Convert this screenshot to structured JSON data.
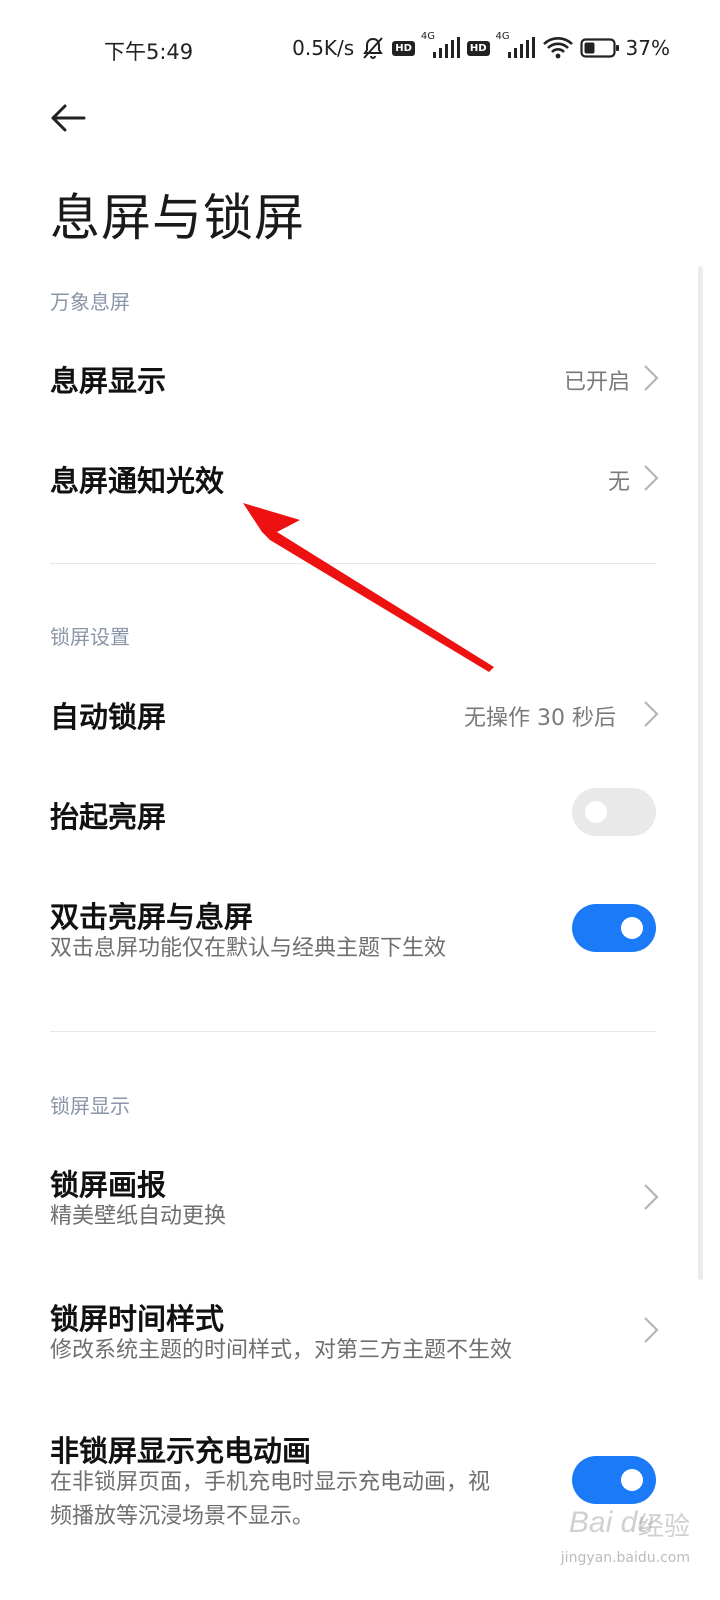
{
  "status_bar": {
    "time": "下午5:49",
    "net_speed": "0.5K/s",
    "sim1_label": "HD",
    "sim1_net": "4G",
    "sim2_label": "HD",
    "sim2_net": "4G",
    "battery": "37%",
    "battery_level": 0.37,
    "icons": [
      "mute-bell-icon",
      "signal-icon",
      "wifi-icon",
      "battery-icon"
    ]
  },
  "header": {
    "back_icon": "back-arrow-icon",
    "title": "息屏与锁屏"
  },
  "sections": {
    "aod": {
      "header": "万象息屏",
      "items": [
        {
          "title": "息屏显示",
          "value": "已开启"
        },
        {
          "title": "息屏通知光效",
          "value": "无"
        }
      ]
    },
    "lock": {
      "header": "锁屏设置",
      "items": [
        {
          "title": "自动锁屏",
          "value": "无操作 30 秒后"
        },
        {
          "title": "抬起亮屏",
          "toggle": false
        },
        {
          "title": "双击亮屏与息屏",
          "subtitle": "双击息屏功能仅在默认与经典主题下生效",
          "toggle": true
        }
      ]
    },
    "display": {
      "header": "锁屏显示",
      "items": [
        {
          "title": "锁屏画报",
          "subtitle": "精美壁纸自动更换"
        },
        {
          "title": "锁屏时间样式",
          "subtitle": "修改系统主题的时间样式，对第三方主题不生效"
        },
        {
          "title": "非锁屏显示充电动画",
          "subtitle_line1": "在非锁屏页面，手机充电时显示充电动画，视",
          "subtitle_line2": "频播放等沉浸场景不显示。",
          "toggle": true
        }
      ]
    }
  },
  "watermark": {
    "brand": "Bai du",
    "jingyan": "经验",
    "url": "jingyan.baidu.com"
  },
  "colors": {
    "accent": "#1a7af8",
    "toggle_off": "#e9e9e9",
    "section_header": "#8a96a8",
    "annotation_arrow": "#ee1111"
  }
}
